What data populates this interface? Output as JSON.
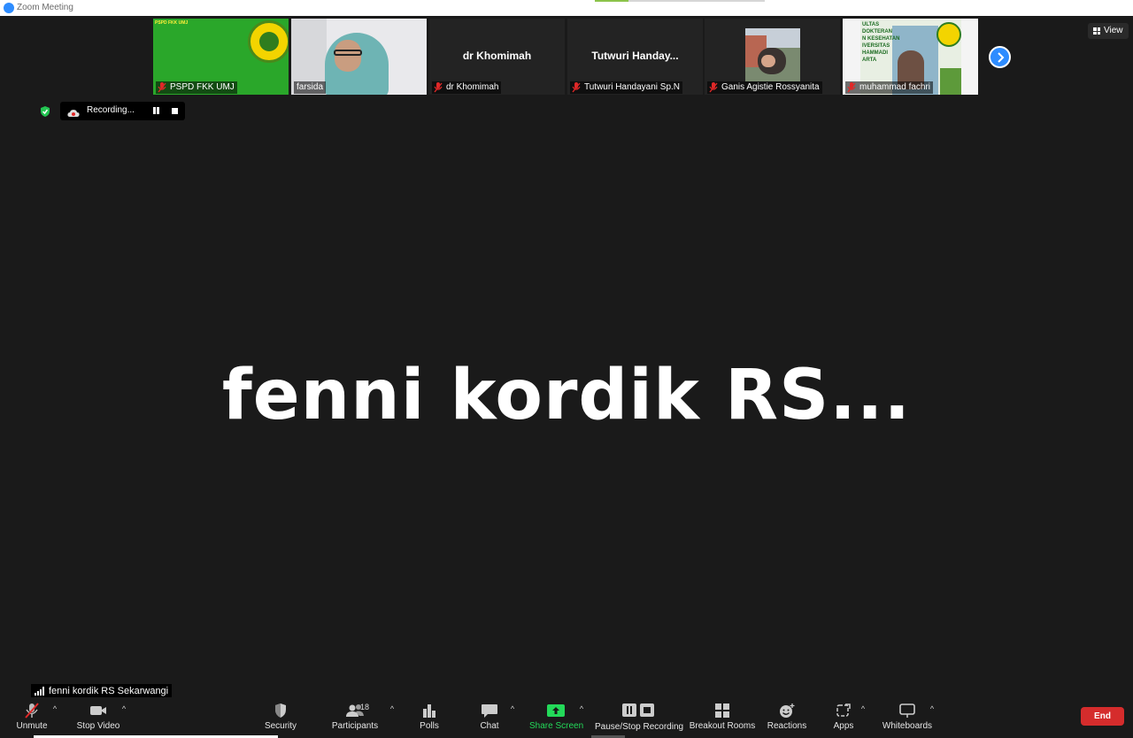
{
  "window": {
    "title": "Zoom Meeting"
  },
  "gallery": {
    "tiles": [
      {
        "name": "PSPD FKK UMJ",
        "banner": "PSPD FKK UMJ",
        "muted": true
      },
      {
        "name": "farsida",
        "muted": false
      },
      {
        "name": "dr Khomimah",
        "center_name": "dr Khomimah",
        "muted": true
      },
      {
        "name": "Tutwuri Handayani Sp.N",
        "center_name": "Tutwuri  Handay...",
        "muted": true
      },
      {
        "name": "Ganis Agistie Rossyanita",
        "muted": true
      },
      {
        "name": "muhammad fachri",
        "banner": "ULTAS\nDOKTERAN\nN KESEHATAN\nIVERSITAS\nHAMMADI\nARTA",
        "muted": true
      }
    ],
    "view_label": "View"
  },
  "recording": {
    "status": "Recording..."
  },
  "main": {
    "speaker_display": "fenni  kordik  RS..."
  },
  "active_speaker": {
    "label": "fenni kordik RS Sekarwangi"
  },
  "toolbar": {
    "unmute": "Unmute",
    "stop_video": "Stop Video",
    "security": "Security",
    "participants": "Participants",
    "participants_count": "18",
    "polls": "Polls",
    "chat": "Chat",
    "share_screen": "Share Screen",
    "pause_stop_recording": "Pause/Stop Recording",
    "breakout_rooms": "Breakout Rooms",
    "reactions": "Reactions",
    "apps": "Apps",
    "whiteboards": "Whiteboards",
    "end": "End"
  },
  "colors": {
    "background": "#1a1a1a",
    "accent": "#2d8cff",
    "share_green": "#23d959",
    "end_red": "#d52c2c",
    "mute_red": "#e02828"
  }
}
